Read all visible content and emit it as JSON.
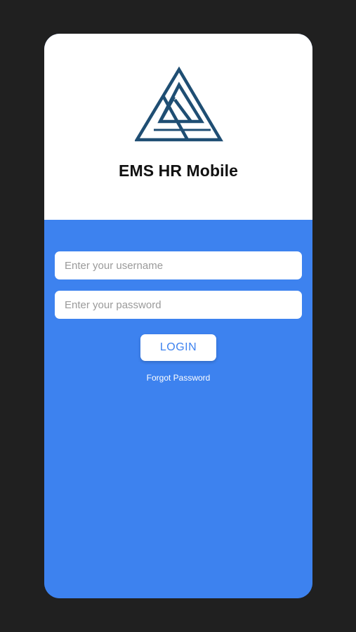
{
  "app": {
    "title": "EMS HR Mobile",
    "logo_icon": "triangle-logo-icon",
    "colors": {
      "background": "#202020",
      "header": "#ffffff",
      "accent": "#3d82ef",
      "logo": "#1f4e73"
    }
  },
  "form": {
    "username_placeholder": "Enter your username",
    "username_value": "",
    "password_placeholder": "Enter your password",
    "password_value": "",
    "login_label": "LOGIN",
    "forgot_label": "Forgot Password"
  }
}
